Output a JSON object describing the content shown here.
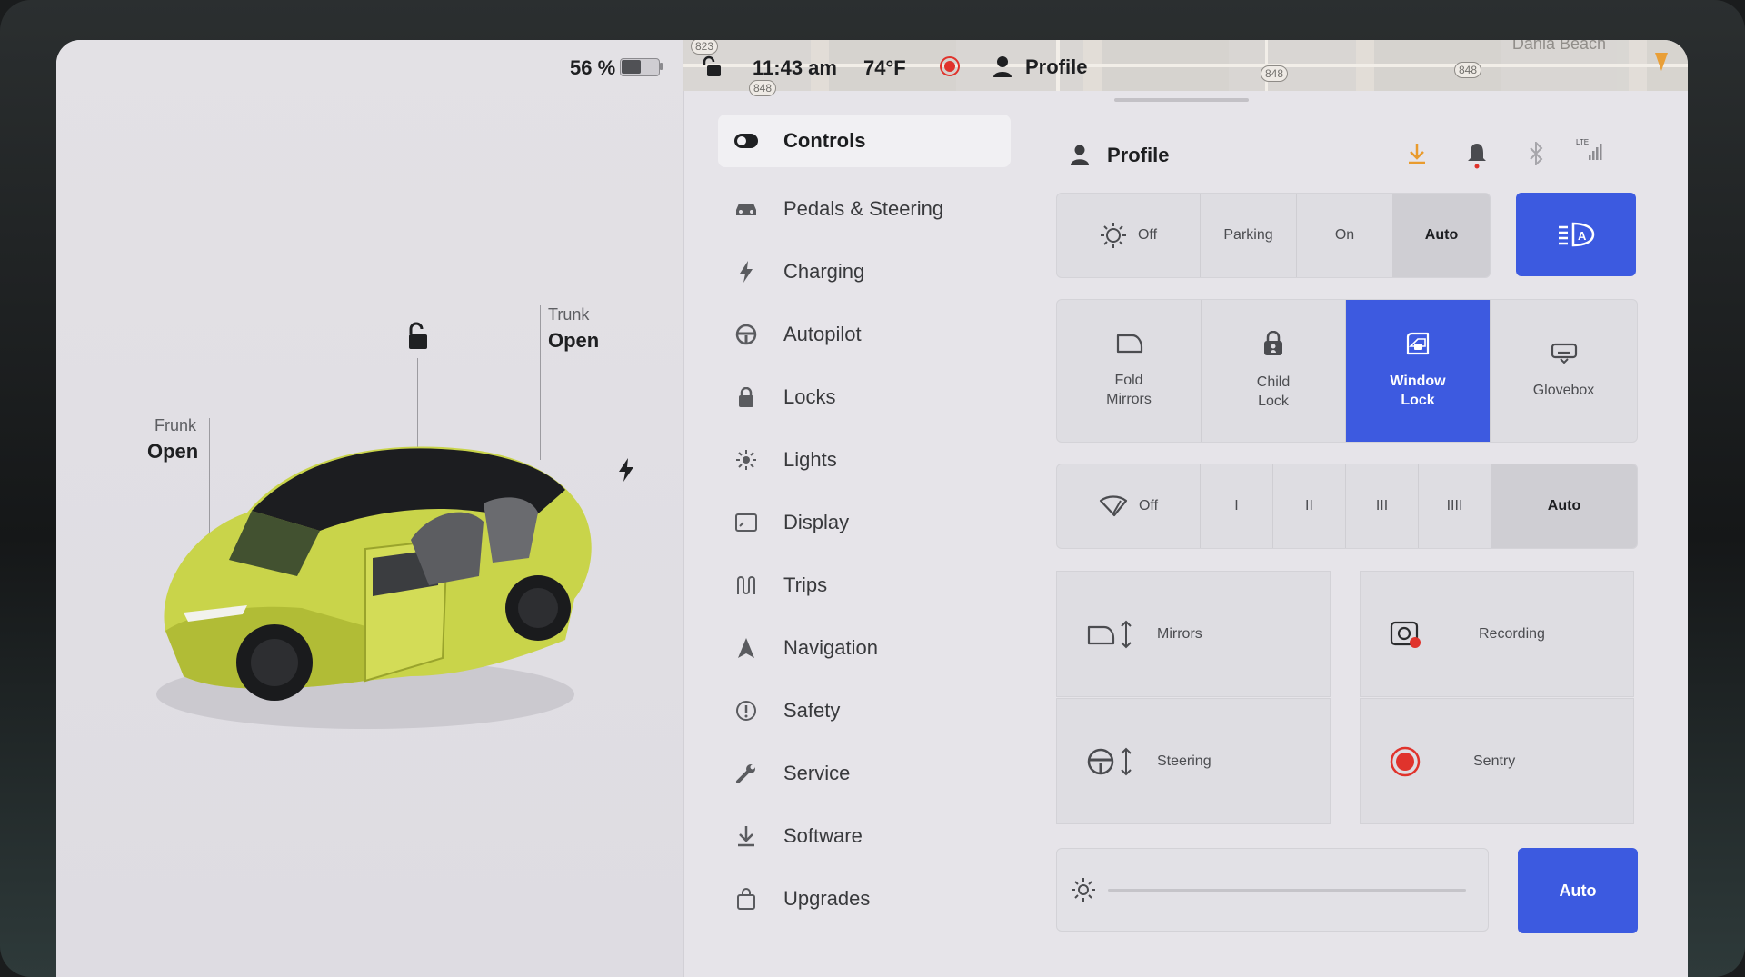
{
  "status_bar": {
    "battery_percent_label": "56 %",
    "battery_level": 0.56,
    "time": "11:43 am",
    "temperature": "74°F",
    "profile_label": "Profile"
  },
  "map": {
    "place_label": "Dania Beach",
    "route_shields": [
      "823",
      "848",
      "848",
      "848"
    ]
  },
  "car": {
    "frunk_title": "Frunk",
    "frunk_state": "Open",
    "trunk_title": "Trunk",
    "trunk_state": "Open",
    "body_color": "#c9d44a"
  },
  "menu": {
    "items": [
      {
        "label": "Controls",
        "icon": "toggle-icon",
        "active": true
      },
      {
        "label": "Pedals & Steering",
        "icon": "car-icon"
      },
      {
        "label": "Charging",
        "icon": "bolt-icon"
      },
      {
        "label": "Autopilot",
        "icon": "steering-wheel-icon"
      },
      {
        "label": "Locks",
        "icon": "lock-icon"
      },
      {
        "label": "Lights",
        "icon": "sun-icon"
      },
      {
        "label": "Display",
        "icon": "display-icon"
      },
      {
        "label": "Trips",
        "icon": "trips-icon"
      },
      {
        "label": "Navigation",
        "icon": "navigation-arrow-icon"
      },
      {
        "label": "Safety",
        "icon": "alert-circle-icon"
      },
      {
        "label": "Service",
        "icon": "wrench-icon"
      },
      {
        "label": "Software",
        "icon": "download-icon"
      },
      {
        "label": "Upgrades",
        "icon": "shopping-bag-icon"
      }
    ]
  },
  "panel": {
    "profile_label": "Profile",
    "header_icons": [
      "download-icon",
      "bell-icon",
      "bluetooth-icon",
      "lte-signal-icon"
    ],
    "lte_label": "LTE",
    "headlights": {
      "options": [
        "Off",
        "Parking",
        "On",
        "Auto"
      ],
      "selected": "Auto"
    },
    "tiles": [
      {
        "line1": "Fold",
        "line2": "Mirrors",
        "icon": "mirror-icon",
        "active": false
      },
      {
        "line1": "Child",
        "line2": "Lock",
        "icon": "child-lock-icon",
        "active": false
      },
      {
        "line1": "Window",
        "line2": "Lock",
        "icon": "window-lock-icon",
        "active": true
      },
      {
        "line1": "Glovebox",
        "line2": "",
        "icon": "glovebox-icon",
        "active": false
      }
    ],
    "wipers": {
      "options": [
        "Off",
        "I",
        "II",
        "III",
        "IIII",
        "Auto"
      ],
      "selected": "Auto"
    },
    "grid": {
      "mirrors": "Mirrors",
      "recording": "Recording",
      "steering": "Steering",
      "sentry": "Sentry"
    },
    "brightness_auto_label": "Auto"
  },
  "colors": {
    "accent_blue": "#3c5ae0",
    "record_red": "#e0332c",
    "download_orange": "#e99b2e"
  }
}
